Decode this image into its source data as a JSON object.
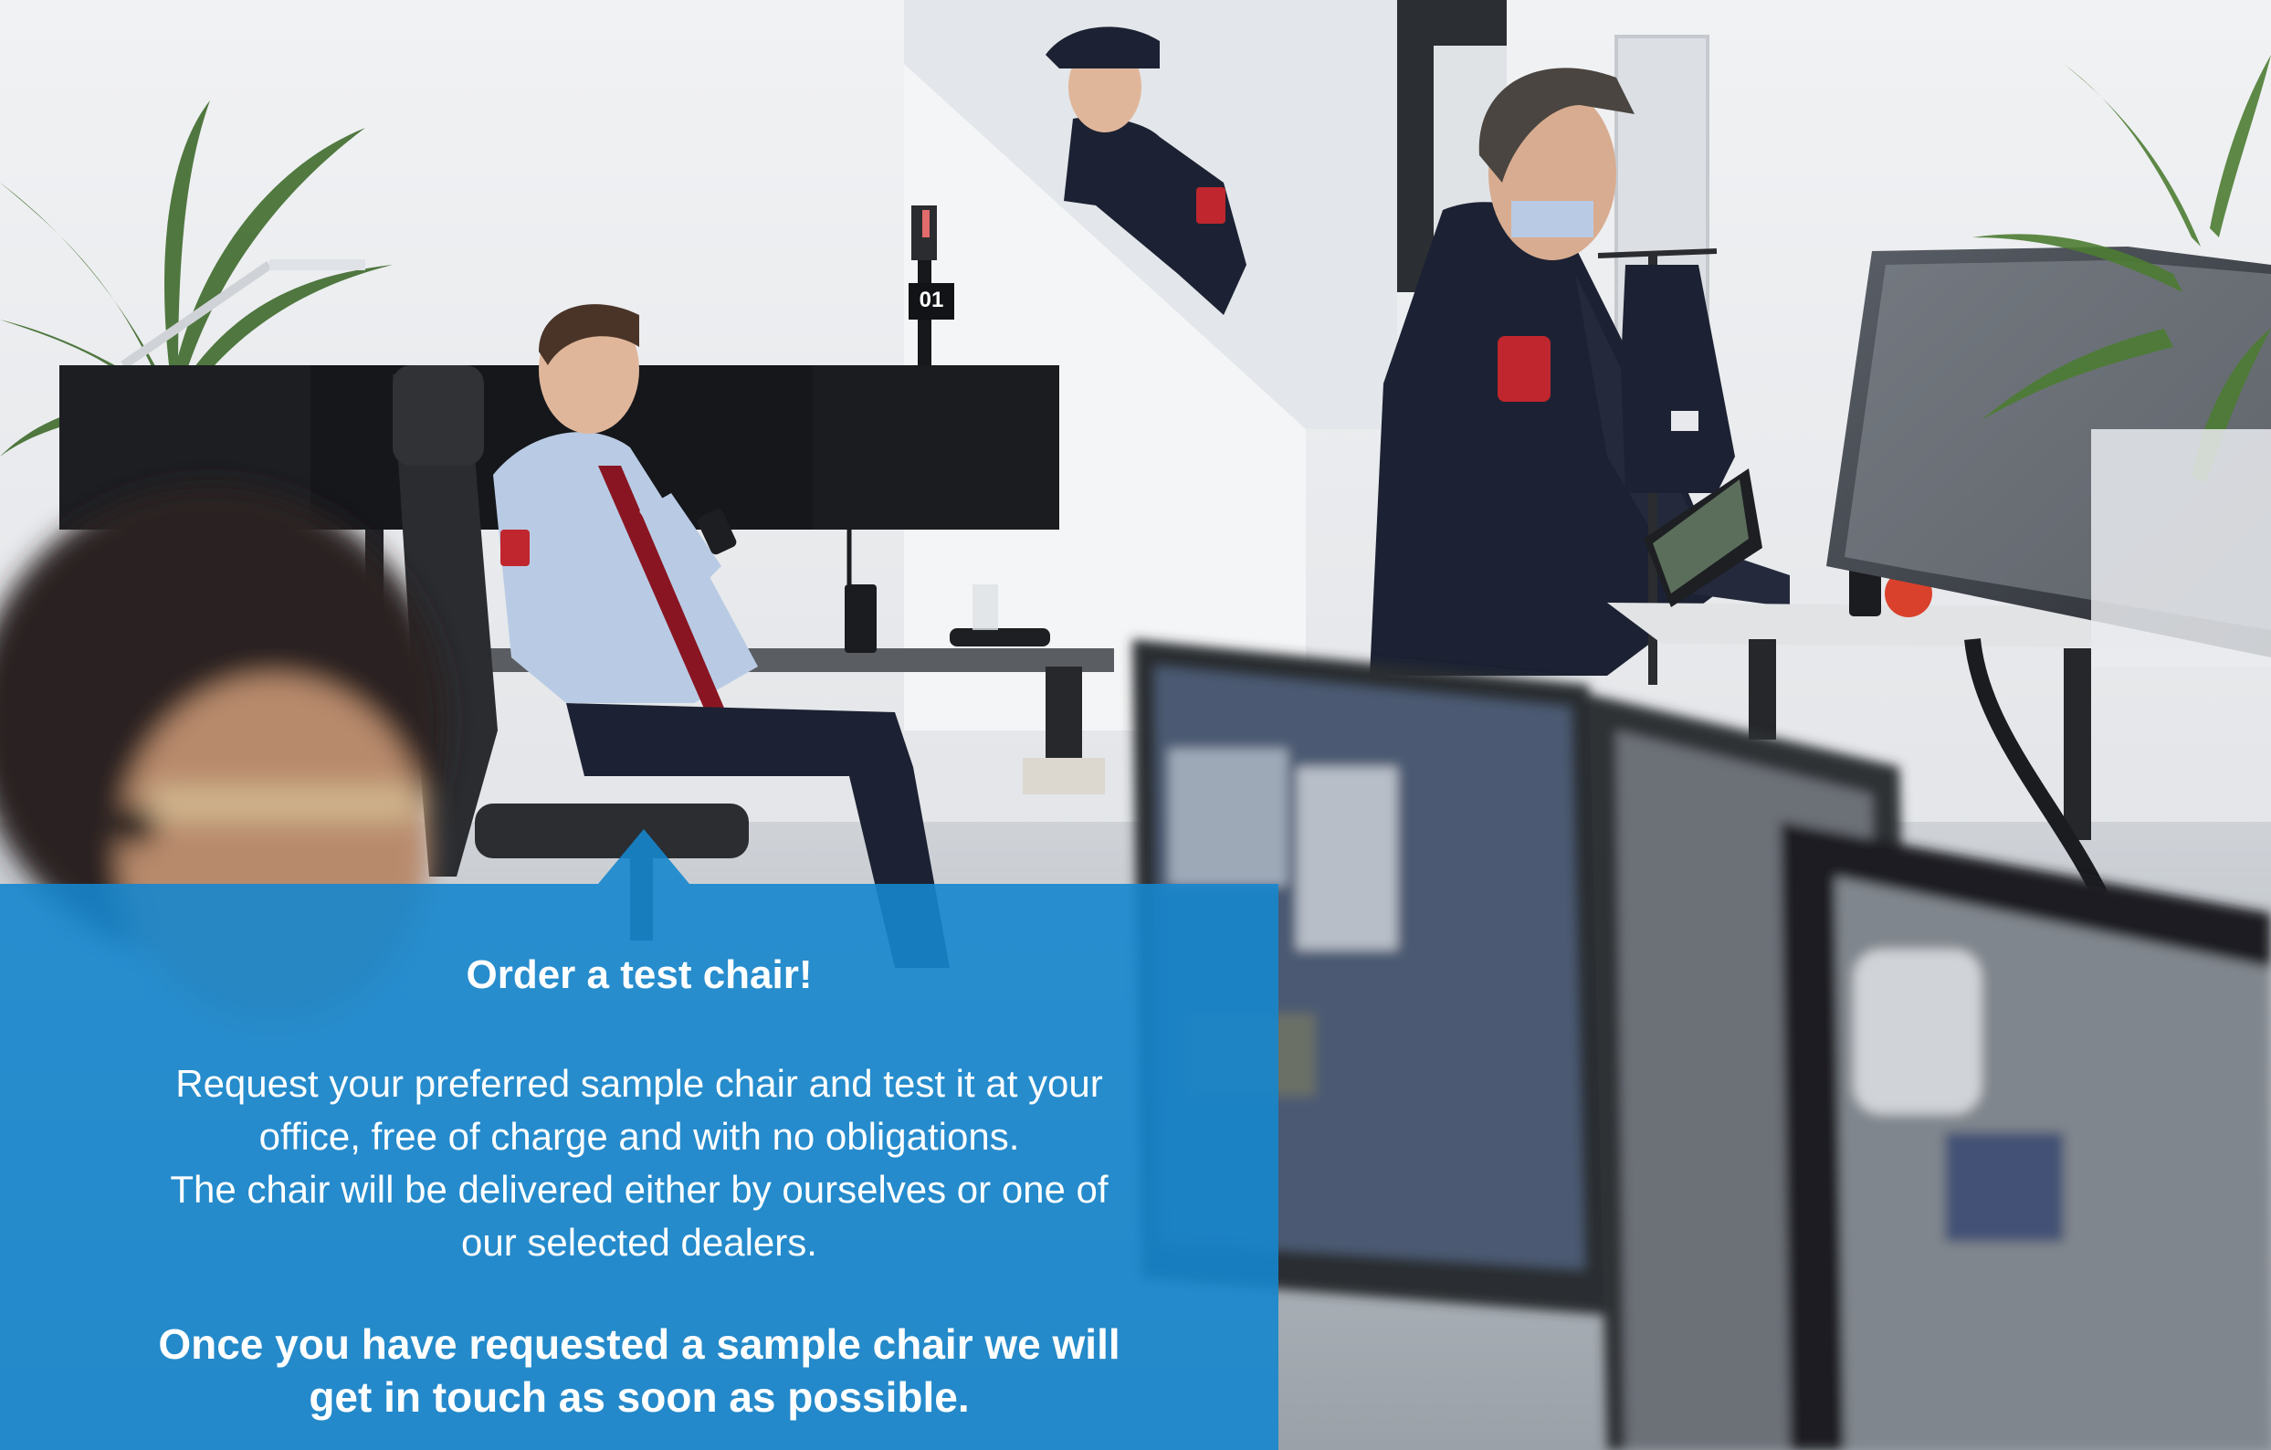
{
  "promo": {
    "title": "Order a test chair!",
    "body_lines": [
      "Request your preferred sample chair and test it at your",
      "office, free of charge and with no obligations.",
      "The chair will be delivered either by ourselves or one of",
      "our selected dealers."
    ],
    "cta_lines": [
      "Once you have requested a sample chair we will",
      "get in touch as soon as possible."
    ]
  },
  "photo": {
    "monitor_tag": "01",
    "colors": {
      "panel_blue": "#1686cd",
      "wall": "#eef0f2",
      "uniform_navy": "#1c2233",
      "shirt_blue": "#b9cbe4",
      "tie_red": "#8a1522",
      "badge_red": "#c0262d"
    }
  }
}
